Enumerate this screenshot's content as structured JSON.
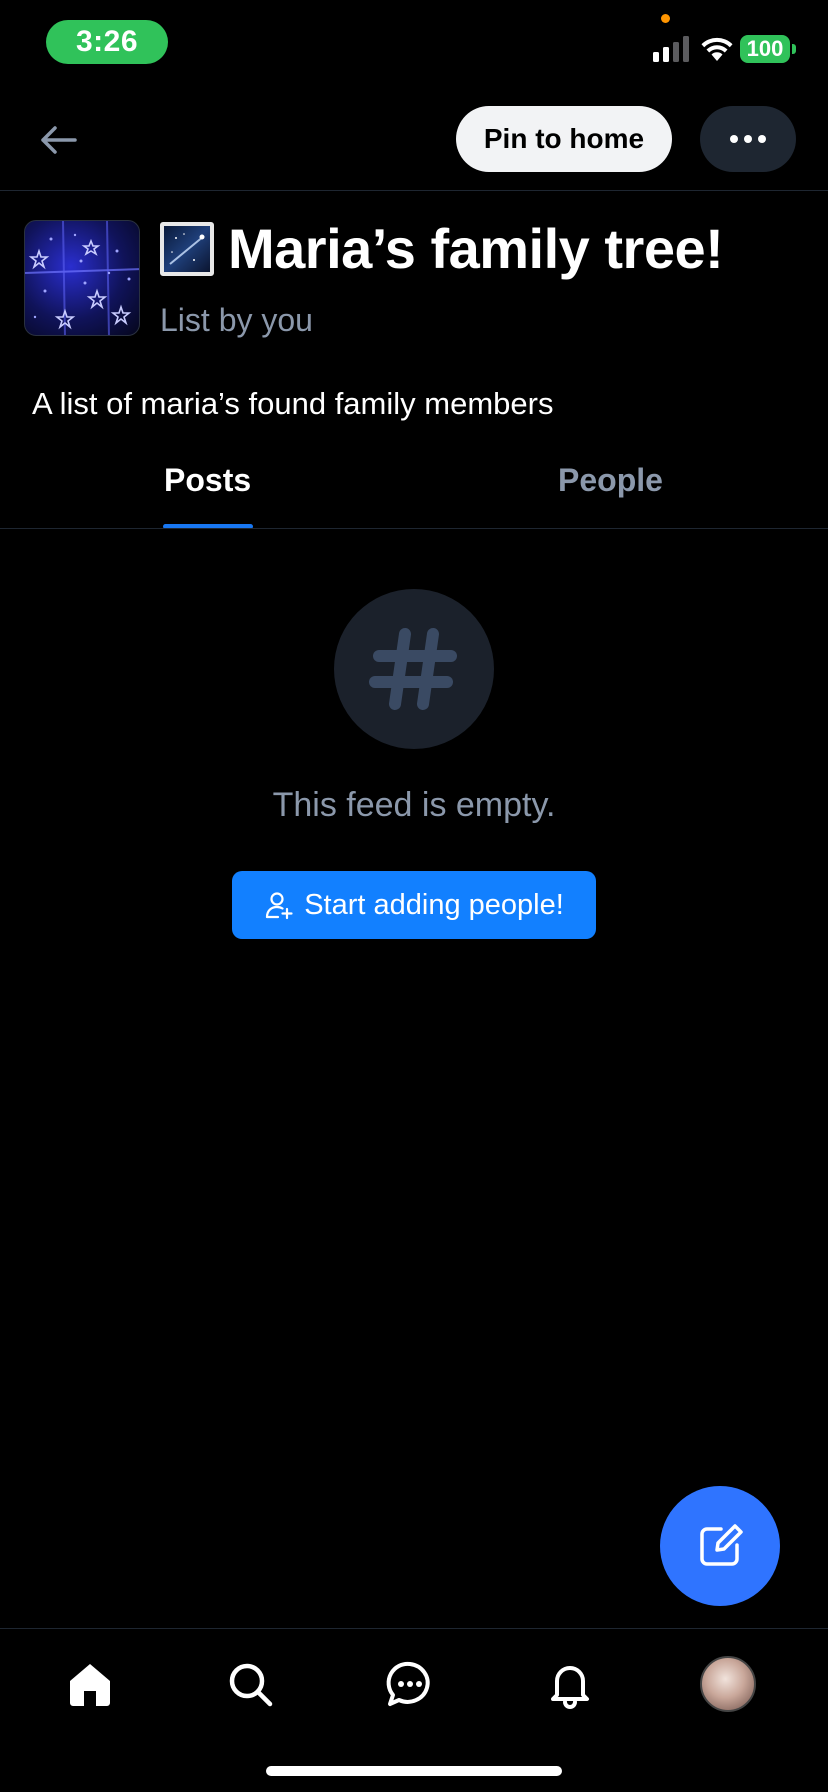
{
  "status_bar": {
    "time": "3:26",
    "battery": "100"
  },
  "header": {
    "pin_label": "Pin to home"
  },
  "list": {
    "title": "Maria’s family tree!",
    "subtitle": "List by you",
    "description": "A list of maria’s found family members"
  },
  "tabs": [
    {
      "label": "Posts",
      "active": true
    },
    {
      "label": "People",
      "active": false
    }
  ],
  "empty_state": {
    "message": "This feed is empty.",
    "button_label": "Start adding people!"
  },
  "nav": {
    "items": [
      {
        "icon": "home-icon"
      },
      {
        "icon": "search-icon"
      },
      {
        "icon": "chat-icon"
      },
      {
        "icon": "bell-icon"
      },
      {
        "icon": "profile-avatar"
      }
    ]
  },
  "colors": {
    "accent": "#1280ff",
    "fab": "#2f74ff",
    "muted_text": "#8b98ab",
    "status_green": "#30c25a"
  }
}
